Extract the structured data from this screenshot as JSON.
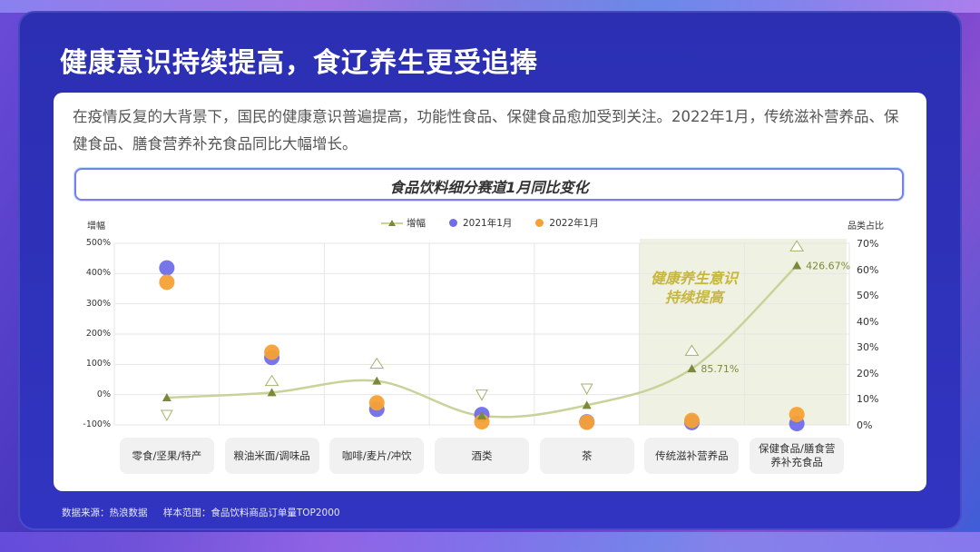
{
  "title": "健康意识持续提高，食辽养生更受追捧",
  "intro": "在疫情反复的大背景下，国民的健康意识普遍提高，功能性食品、保健食品愈加受到关注。2022年1月，传统滋补营养品、保健食品、膳食营养补充食品同比大幅增长。",
  "chart_data": {
    "type": "line",
    "title": "食品饮料细分赛道1月同比变化",
    "ylabel_left": "增幅",
    "ylabel_right": "品类占比",
    "categories": [
      "零食/坚果/特产",
      "粮油米面/调味品",
      "咖啡/麦片/冲饮",
      "酒类",
      "茶",
      "传统滋补营养品",
      "保健食品/膳食营养补充食品"
    ],
    "category_labels": [
      "零食/坚果/特产",
      "粮油米面/调味品",
      "咖啡/麦片/冲饮",
      "酒类",
      "茶",
      "传统滋补营养品",
      "保健食品/膳食营\n养补充食品"
    ],
    "left_axis": {
      "min": -100,
      "max": 500,
      "ticks": [
        "500%",
        "400%",
        "300%",
        "200%",
        "100%",
        "0%",
        "-100%"
      ]
    },
    "right_axis": {
      "min": 0,
      "max": 70,
      "ticks": [
        "70%",
        "60%",
        "50%",
        "40%",
        "30%",
        "20%",
        "10%",
        "0%"
      ]
    },
    "series": [
      {
        "name": "增幅",
        "axis": "left",
        "values": [
          -10,
          7,
          45,
          -70,
          -35,
          85.71,
          426.67
        ],
        "labels": [
          "",
          "",
          "",
          "",
          "",
          "85.71%",
          "426.67%"
        ],
        "color": "#c8d39a"
      },
      {
        "name": "2021年1月",
        "axis": "right",
        "values": [
          60.5,
          26,
          6,
          4,
          1.2,
          0.9,
          0.5
        ],
        "color": "#6f6ee8"
      },
      {
        "name": "2022年1月",
        "axis": "right",
        "values": [
          55,
          28,
          8.5,
          1.2,
          1,
          1.7,
          4
        ],
        "color": "#f5a134"
      }
    ],
    "triangle_markers": [
      -67,
      45,
      102,
      0,
      20,
      145,
      490
    ],
    "annotation": "健康养生意识\n持续提高"
  },
  "footer": {
    "source": "数据来源：热浪数据",
    "scope": "样本范围：食品饮料商品订单量TOP2000"
  }
}
